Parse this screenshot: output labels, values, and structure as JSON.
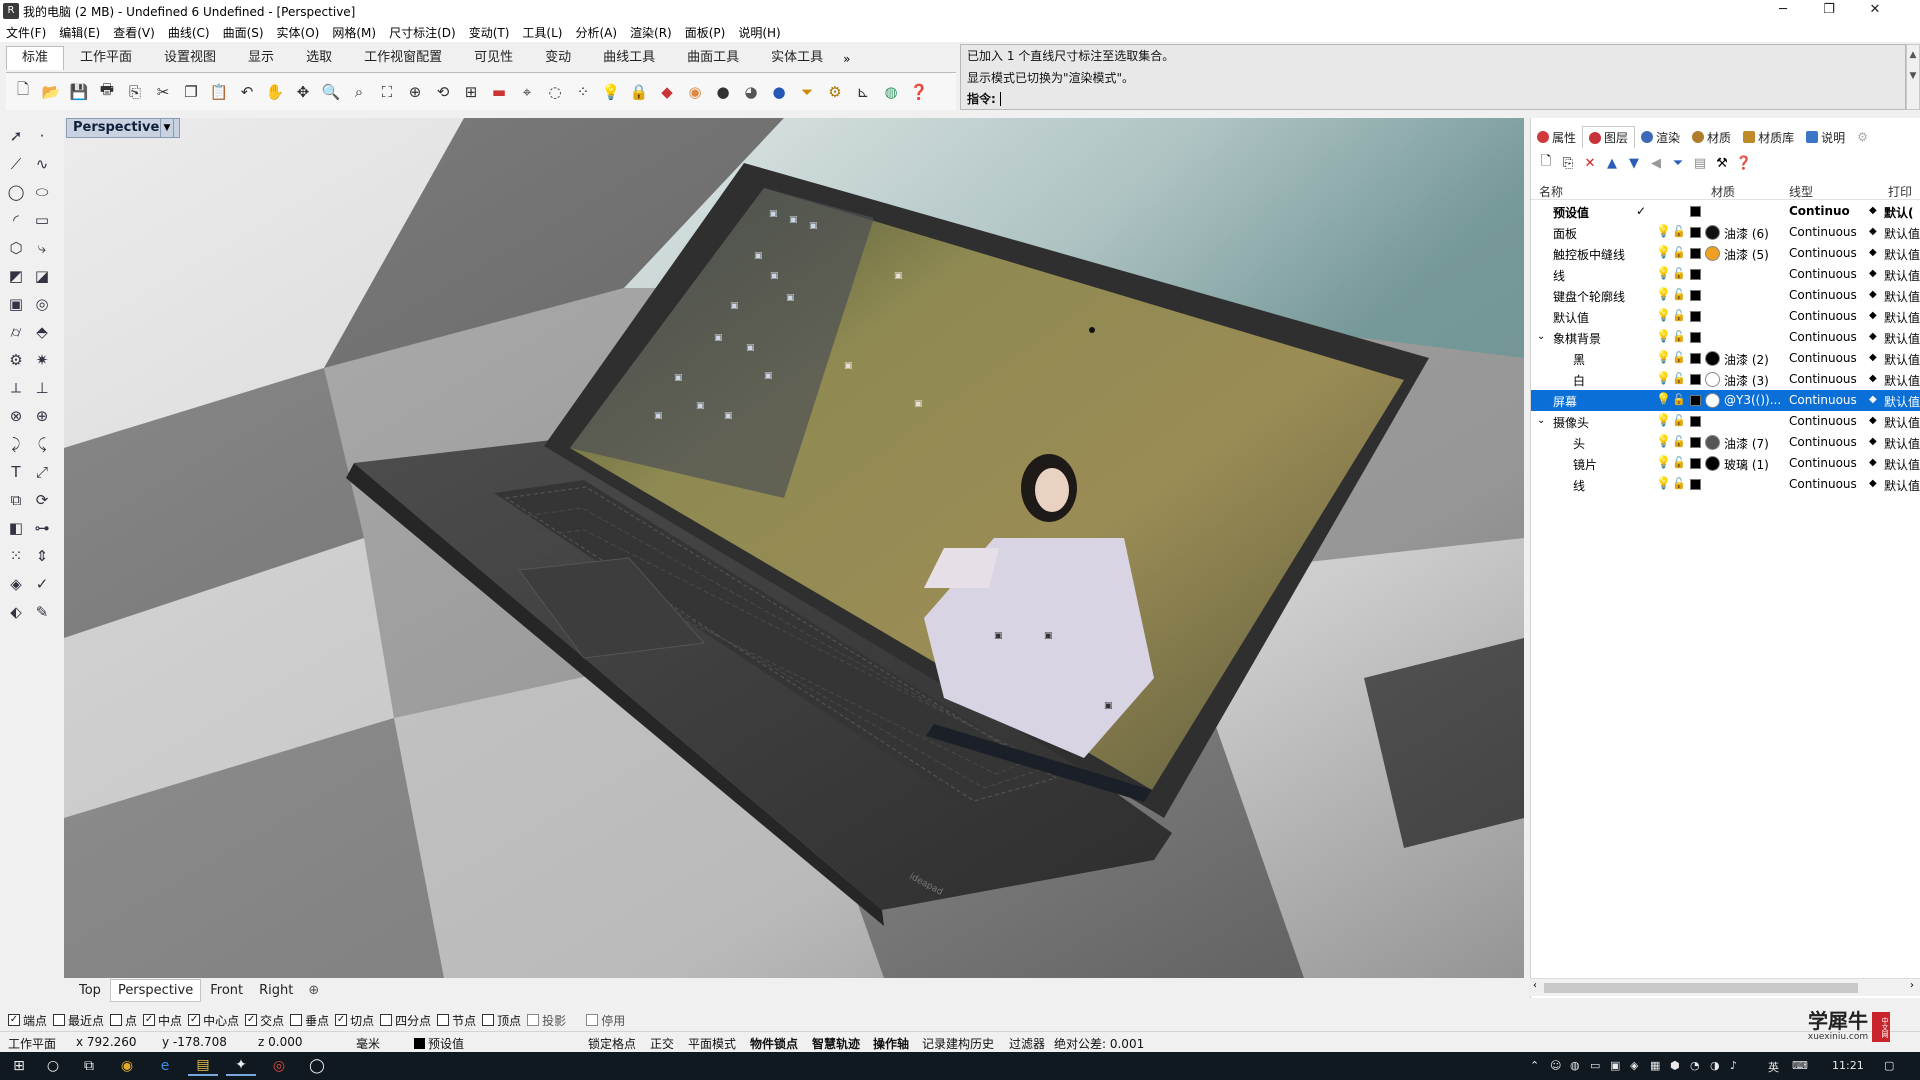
{
  "window": {
    "title": "我的电脑 (2 MB) - Undefined 6 Undefined - [Perspective]",
    "controls": [
      "─",
      "❐",
      "✕"
    ]
  },
  "menu": [
    "文件(F)",
    "编辑(E)",
    "查看(V)",
    "曲线(C)",
    "曲面(S)",
    "实体(O)",
    "网格(M)",
    "尺寸标注(D)",
    "变动(T)",
    "工具(L)",
    "分析(A)",
    "渲染(R)",
    "面板(P)",
    "说明(H)"
  ],
  "toolbar_tabs": [
    "标准",
    "工作平面",
    "设置视图",
    "显示",
    "选取",
    "工作视窗配置",
    "可见性",
    "变动",
    "曲线工具",
    "曲面工具",
    "实体工具"
  ],
  "toolbar_more": "»",
  "command": {
    "history": [
      "已加入 1 个直线尺寸标注至选取集合。",
      "显示模式已切换为\"渲染模式\"。"
    ],
    "prompt": "指令:"
  },
  "viewport": {
    "title": "Perspective",
    "screen_icons": [
      "▣",
      "▣",
      "▣",
      "▣",
      "▣",
      "▣",
      "▣",
      "▣",
      "▣",
      "▣",
      "▣",
      "▣",
      "▣",
      "▣",
      "▣",
      "▣",
      "▣",
      "▣",
      "▣",
      "▣"
    ],
    "tabs": [
      "Top",
      "Perspective",
      "Front",
      "Right"
    ],
    "add_tab": "⊕",
    "brand": "ideapad"
  },
  "panel": {
    "tabs": [
      {
        "label": "属性",
        "color": "#d13a3a"
      },
      {
        "label": "图层",
        "color": "#c9333a"
      },
      {
        "label": "渲染",
        "color": "#3d6ab8"
      },
      {
        "label": "材质",
        "color": "#b07b2a"
      },
      {
        "label": "材质库",
        "color": "#c08a28"
      },
      {
        "label": "说明",
        "color": "#3b76c6"
      }
    ],
    "columns": {
      "name": "名称",
      "material": "材质",
      "linetype": "线型",
      "print": "打印"
    },
    "layers": [
      {
        "name": "预设值",
        "bold": true,
        "check": "✓",
        "swatch": "#000000",
        "material_color": "",
        "material": "",
        "linetype": "Continuo",
        "print": "默认(",
        "indent": 0
      },
      {
        "name": "面板",
        "swatch": "#000000",
        "material_color": "#111111",
        "material": "油漆 (6)",
        "linetype": "Continuous",
        "print": "默认值",
        "indent": 0
      },
      {
        "name": "触控板中缝线",
        "swatch": "#000000",
        "material_color": "#f0a020",
        "material": "油漆 (5)",
        "linetype": "Continuous",
        "print": "默认值",
        "indent": 0
      },
      {
        "name": "线",
        "swatch": "#000000",
        "material_color": "",
        "material": "",
        "linetype": "Continuous",
        "print": "默认值",
        "indent": 0
      },
      {
        "name": "键盘个轮廓线",
        "swatch": "#000000",
        "material_color": "",
        "material": "",
        "linetype": "Continuous",
        "print": "默认值",
        "indent": 0
      },
      {
        "name": "默认值",
        "swatch": "#000000",
        "material_color": "",
        "material": "",
        "linetype": "Continuous",
        "print": "默认值",
        "indent": 0
      },
      {
        "name": "象棋背景",
        "expand": "⌄",
        "swatch": "#000000",
        "material_color": "",
        "material": "",
        "linetype": "Continuous",
        "print": "默认值",
        "indent": 0
      },
      {
        "name": "黑",
        "swatch": "#000000",
        "material_color": "#000000",
        "material": "油漆 (2)",
        "linetype": "Continuous",
        "print": "默认值",
        "indent": 1
      },
      {
        "name": "白",
        "swatch": "#000000",
        "material_color": "#ffffff",
        "material": "油漆 (3)",
        "linetype": "Continuous",
        "print": "默认值",
        "indent": 1
      },
      {
        "name": "屏幕",
        "selected": true,
        "swatch": "#000000",
        "material_color": "#ffffff",
        "material": "@Y3(())...",
        "linetype": "Continuous",
        "print": "默认值",
        "indent": 0
      },
      {
        "name": "摄像头",
        "expand": "⌄",
        "swatch": "#000000",
        "material_color": "",
        "material": "",
        "linetype": "Continuous",
        "print": "默认值",
        "indent": 0
      },
      {
        "name": "头",
        "swatch": "#000000",
        "material_color": "#555555",
        "material": "油漆 (7)",
        "linetype": "Continuous",
        "print": "默认值",
        "indent": 1
      },
      {
        "name": "镜片",
        "swatch": "#000000",
        "material_color": "#000000",
        "material": "玻璃 (1)",
        "linetype": "Continuous",
        "print": "默认值",
        "indent": 1
      },
      {
        "name": "线",
        "swatch": "#000000",
        "material_color": "",
        "material": "",
        "linetype": "Continuous",
        "print": "默认值",
        "indent": 1
      }
    ]
  },
  "osnaps": [
    {
      "label": "端点",
      "checked": true
    },
    {
      "label": "最近点",
      "checked": false
    },
    {
      "label": "点",
      "checked": false
    },
    {
      "label": "中点",
      "checked": true
    },
    {
      "label": "中心点",
      "checked": true
    },
    {
      "label": "交点",
      "checked": true
    },
    {
      "label": "垂点",
      "checked": false
    },
    {
      "label": "切点",
      "checked": true
    },
    {
      "label": "四分点",
      "checked": false
    },
    {
      "label": "节点",
      "checked": false
    },
    {
      "label": "顶点",
      "checked": false
    },
    {
      "label": "投影",
      "checked": false,
      "dim": true
    },
    {
      "label": "停用",
      "checked": false,
      "dim": true
    }
  ],
  "status": {
    "cplane": "工作平面",
    "x": "x 792.260",
    "y": "y -178.708",
    "z": "z 0.000",
    "unit": "毫米",
    "layer": "预设值",
    "grid_snap": "锁定格点",
    "ortho": "正交",
    "planar": "平面模式",
    "osnap": "物件锁点",
    "smarttrack": "智慧轨迹",
    "gumball": "操作轴",
    "history": "记录建构历史",
    "filter": "过滤器",
    "tolerance": "绝对公差: 0.001"
  },
  "watermark": {
    "name": "学犀牛",
    "url": "xuexiniu.com",
    "seal": "中文网"
  },
  "taskbar": {
    "time": "11:21",
    "ime": "英",
    "start_icon": "⊞",
    "search_icon": "○",
    "taskview_icon": "⧉",
    "apps": [
      "◉",
      "e",
      "▤",
      "✦",
      "◎",
      "◯"
    ],
    "tray_icons": [
      "⌃",
      "☺",
      "◍",
      "▭",
      "▣",
      "◈",
      "▦",
      "⬢",
      "◔",
      "◑",
      "♪"
    ],
    "notify_icon": "▢"
  }
}
